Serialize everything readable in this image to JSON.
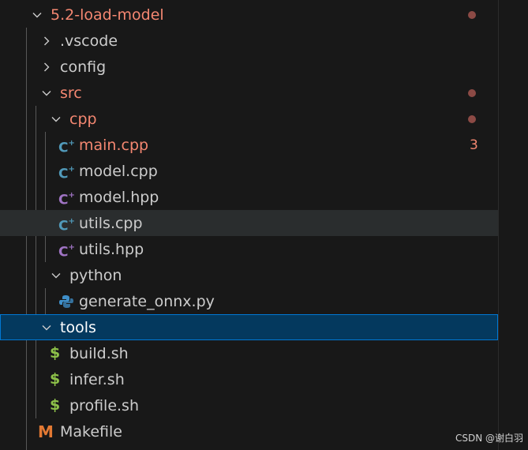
{
  "tree": {
    "root": {
      "label": "5.2-load-model"
    },
    "vscode": {
      "label": ".vscode"
    },
    "config": {
      "label": "config"
    },
    "src": {
      "label": "src"
    },
    "cpp": {
      "label": "cpp"
    },
    "main_cpp": {
      "label": "main.cpp",
      "problems": "3"
    },
    "model_cpp": {
      "label": "model.cpp"
    },
    "model_hpp": {
      "label": "model.hpp"
    },
    "utils_cpp": {
      "label": "utils.cpp"
    },
    "utils_hpp": {
      "label": "utils.hpp"
    },
    "python": {
      "label": "python"
    },
    "generate_onnx": {
      "label": "generate_onnx.py"
    },
    "tools": {
      "label": "tools"
    },
    "build_sh": {
      "label": "build.sh"
    },
    "infer_sh": {
      "label": "infer.sh"
    },
    "profile_sh": {
      "label": "profile.sh"
    },
    "makefile": {
      "label": "Makefile"
    }
  },
  "icons": {
    "cpp_glyph": "C",
    "cpp_plus": "+",
    "shell_glyph": "$",
    "makefile_glyph": "M"
  },
  "colors": {
    "modified": "#f48771",
    "cpp_icon": "#519aba",
    "hpp_icon": "#a074c4",
    "shell_icon": "#8dc149",
    "makefile_icon": "#e37933",
    "selection": "#04395e"
  },
  "watermark": "CSDN @谢白羽"
}
